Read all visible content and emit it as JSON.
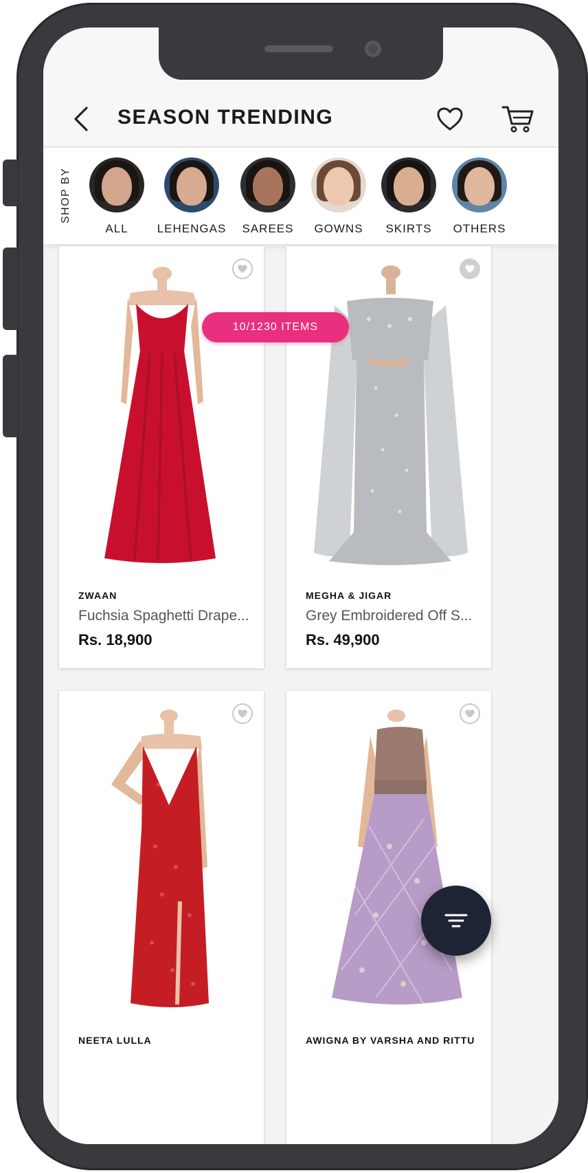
{
  "header": {
    "title": "SEASON TRENDING"
  },
  "categories": {
    "label": "SHOP BY",
    "items": [
      {
        "label": "ALL"
      },
      {
        "label": "LEHENGAS"
      },
      {
        "label": "SAREES"
      },
      {
        "label": "GOWNS"
      },
      {
        "label": "SKIRTS"
      },
      {
        "label": "OTHERS"
      }
    ]
  },
  "listing": {
    "count_label": "10/1230 ITEMS"
  },
  "products": [
    {
      "brand": "ZWAAN",
      "name": "Fuchsia Spaghetti Drape...",
      "price": "Rs. 18,900",
      "dress_color": "#c8102e"
    },
    {
      "brand": "MEGHA & JIGAR",
      "name": "Grey Embroidered Off S...",
      "price": "Rs. 49,900",
      "dress_color": "#b8bcc0"
    },
    {
      "brand": "NEETA LULLA",
      "name": "",
      "price": "",
      "dress_color": "#c41e24"
    },
    {
      "brand": "AWIGNA BY VARSHA AND RITTU",
      "name": "",
      "price": "",
      "dress_color": "#b79cc7"
    }
  ],
  "colors": {
    "accent": "#e8307f",
    "fab": "#1f2336"
  },
  "icons": {
    "back": "chevron-left-icon",
    "wishlist": "heart-icon",
    "cart": "cart-icon",
    "filter": "filter-icon"
  }
}
